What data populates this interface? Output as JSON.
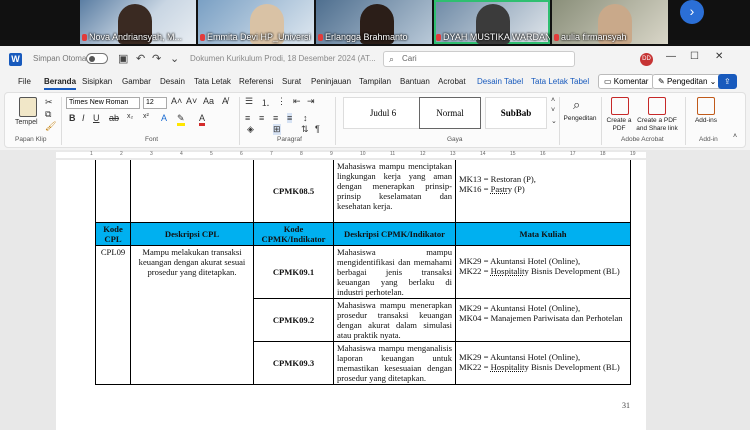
{
  "participants": [
    {
      "name": "Nova Andriansyah, M...",
      "active": false
    },
    {
      "name": "Emmita Devi HP_Universi",
      "active": false
    },
    {
      "name": "Erlangga Brahmanto",
      "active": false
    },
    {
      "name": "DYAH MUSTIKA WARDANI",
      "active": true
    },
    {
      "name": "aulia firmansyah",
      "active": false
    }
  ],
  "next_glyph": "›",
  "word": {
    "app_letter": "W",
    "autosave_label": "Simpan Otomatis",
    "doc_title": "Dokumen Kurikulum Prodi, 18 Desember 2024 (AT...",
    "search_placeholder": "Cari",
    "user_initials": "DD",
    "menu_tabs": [
      "File",
      "Beranda",
      "Sisipkan",
      "Gambar",
      "Desain",
      "Tata Letak",
      "Referensi",
      "Surat",
      "Peninjauan",
      "Tampilan",
      "Bantuan",
      "Acrobat",
      "Desain Tabel",
      "Tata Letak Tabel"
    ],
    "comment_button": "Komentar",
    "editing_button": "Pengeditan",
    "share_button": "⇪",
    "ribbon": {
      "paste_label": "Tempel",
      "clipboard_group": "Papan Klip",
      "font_name": "Times New Roman",
      "font_size": "12",
      "font_group": "Font",
      "paragraph_group": "Paragraf",
      "styles": [
        "Judul 6",
        "Normal",
        "SubBab"
      ],
      "styles_group": "Gaya",
      "editing_label": "Pengeditan",
      "create_pdf": "Create a PDF",
      "create_pdf_share": "Create a PDF and Share link",
      "acrobat_group": "Adobe Acrobat",
      "addins_label": "Add-ins",
      "addins_group": "Add-in"
    },
    "page_number": "31"
  },
  "table": {
    "top_row": {
      "cpmk": "CPMK08.5",
      "indicator": "Mahasiswa mampu menciptakan lingkungan kerja yang aman dengan menerapkan prinsip-prinsip keselamatan dan kesehatan kerja.",
      "courses": [
        "MK13 = Restoran (P),",
        "MK16 = "
      ],
      "course_underlined": "Pastry",
      "course_suffix": " (P)"
    },
    "headers": [
      "Kode CPL",
      "Deskripsi CPL",
      "Kode CPMK/Indikator",
      "Deskripsi CPMK/Indikator",
      "Mata Kuliah"
    ],
    "cpl_code": "CPL09",
    "cpl_desc": "Mampu melakukan transaksi keuangan dengan akurat sesuai prosedur yang ditetapkan.",
    "rows": [
      {
        "cpmk": "CPMK09.1",
        "indicator": "Mahasiswa mampu mengidentifikasi dan memahami berbagai jenis transaksi keuangan yang berlaku di industri perhotelan.",
        "mk1": "MK29 = Akuntansi Hotel (Online),",
        "mk2_prefix": "MK22 = ",
        "mk2_underlined": "Hospitality",
        "mk2_suffix": " Bisnis Development (BL)"
      },
      {
        "cpmk": "CPMK09.2",
        "indicator": "Mahasiswa mampu menerapkan prosedur transaksi keuangan dengan akurat dalam simulasi atau praktik nyata.",
        "mk1": "MK29 = Akuntansi Hotel (Online),",
        "mk2_prefix": "MK04 = Manajemen Pariwisata dan Perhotelan",
        "mk2_underlined": "",
        "mk2_suffix": ""
      },
      {
        "cpmk": "CPMK09.3",
        "indicator": "Mahasiswa mampu menganalisis laporan keuangan untuk memastikan kesesuaian dengan prosedur yang ditetapkan.",
        "mk1": "MK29 = Akuntansi Hotel (Online),",
        "mk2_prefix": "MK22 = ",
        "mk2_underlined": "Hospitality",
        "mk2_suffix": " Bisnis Development (BL)"
      }
    ]
  },
  "colors": {
    "header_fill": "#00b0f0",
    "word_blue": "#185abd",
    "active_speaker": "#2fbf71"
  }
}
